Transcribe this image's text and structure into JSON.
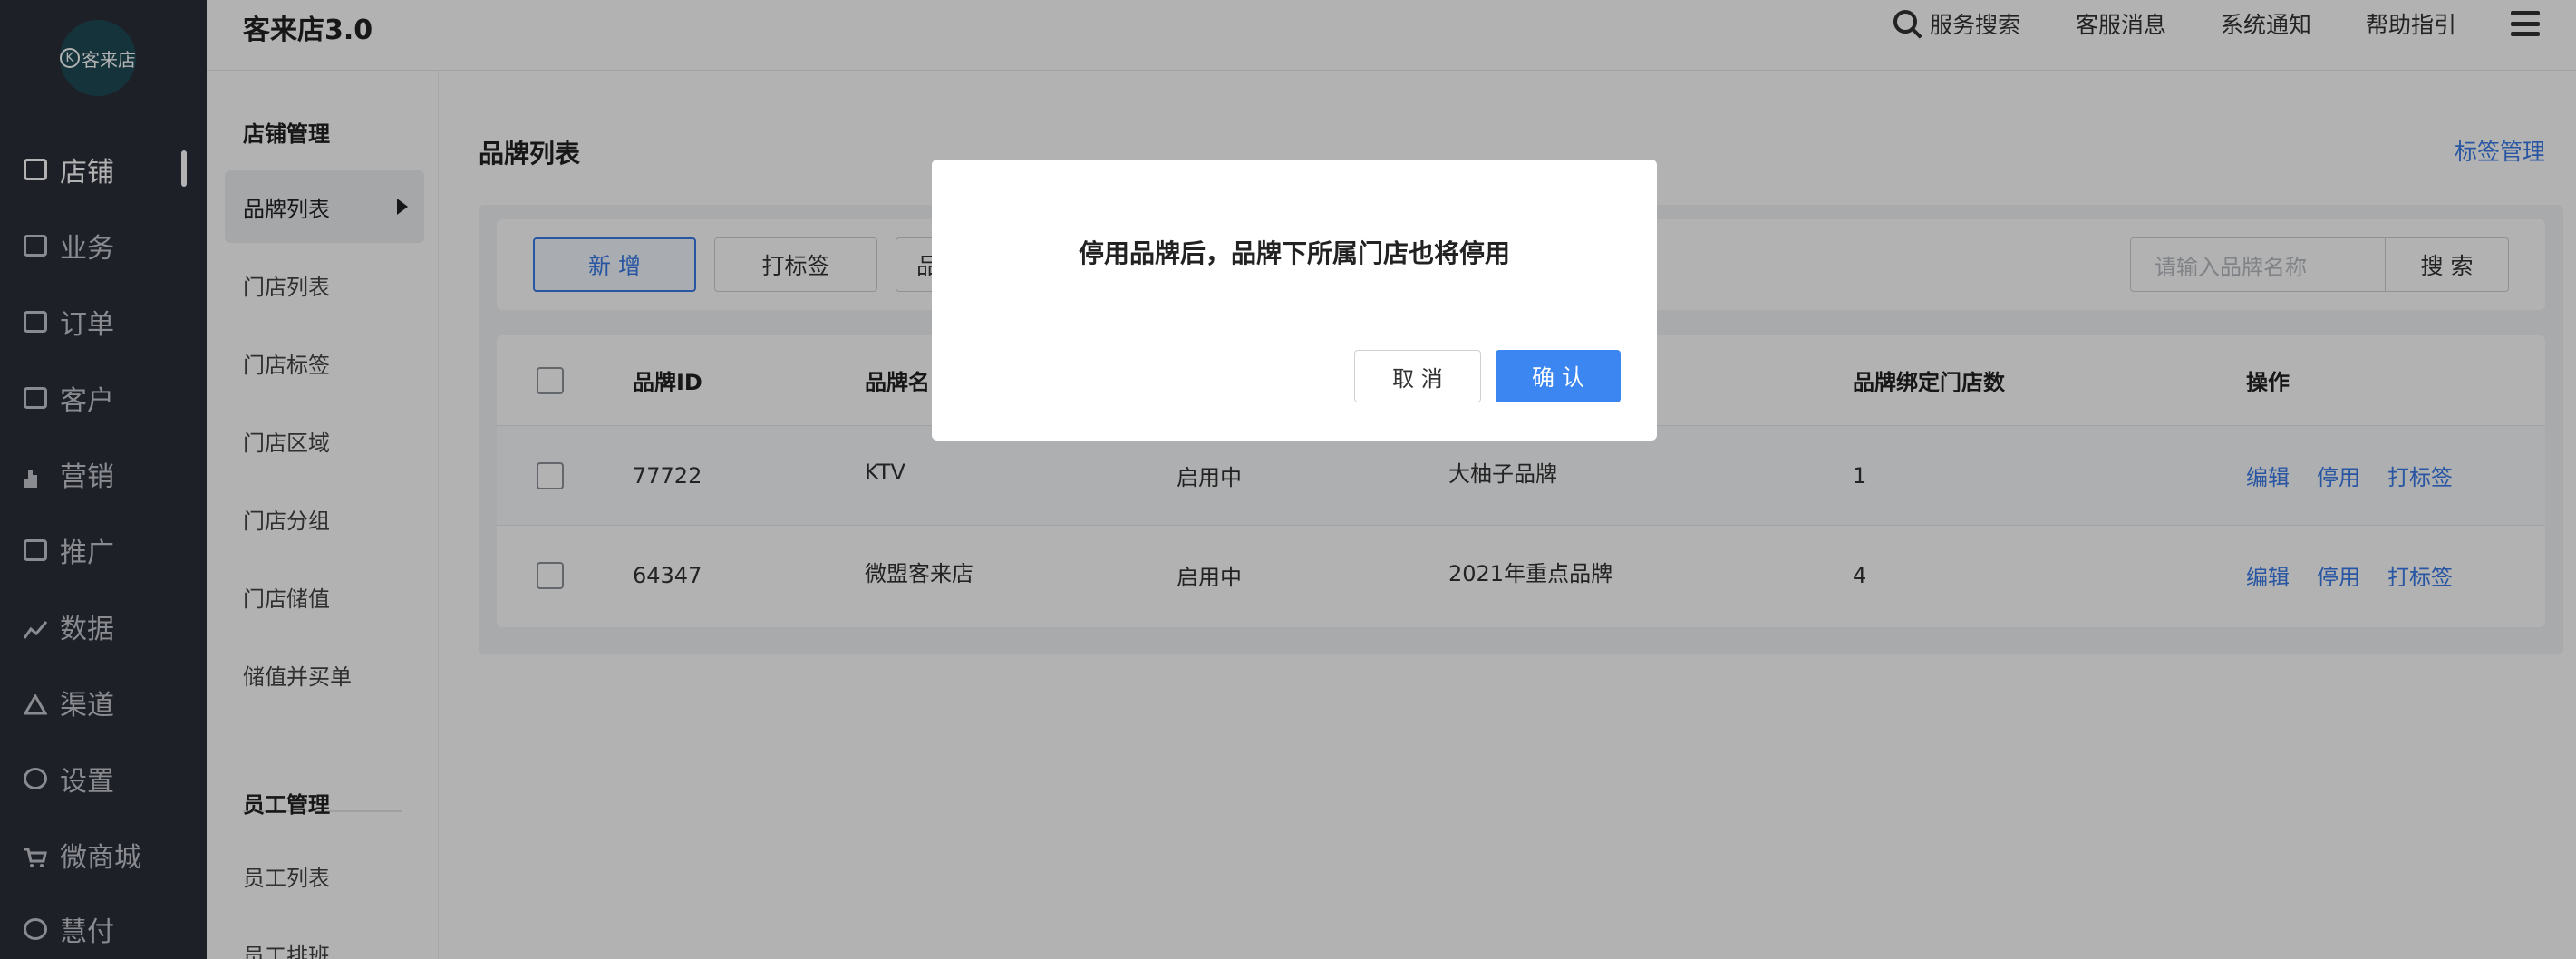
{
  "app": {
    "title": "客来店3.0",
    "logo_text": "客来店",
    "logo_letter": "K"
  },
  "topbar": {
    "search_label": "服务搜索",
    "links": [
      "客服消息",
      "系统通知",
      "帮助指引"
    ]
  },
  "leftnav": {
    "items": [
      {
        "label": "店铺",
        "icon": "store-icon",
        "active": true
      },
      {
        "label": "业务",
        "icon": "briefcase-icon"
      },
      {
        "label": "订单",
        "icon": "order-icon"
      },
      {
        "label": "客户",
        "icon": "vip-card-icon"
      },
      {
        "label": "营销",
        "icon": "bar-chart-icon"
      },
      {
        "label": "推广",
        "icon": "monitor-icon"
      },
      {
        "label": "数据",
        "icon": "line-chart-icon"
      },
      {
        "label": "渠道",
        "icon": "channel-icon"
      },
      {
        "label": "设置",
        "icon": "gear-icon"
      },
      {
        "label": "微商城",
        "icon": "cart-icon"
      },
      {
        "label": "慧付",
        "icon": "pay-icon"
      }
    ]
  },
  "subnav": {
    "group1": "店铺管理",
    "items1": [
      "品牌列表",
      "门店列表",
      "门店标签",
      "门店区域",
      "门店分组",
      "门店储值",
      "储值并买单"
    ],
    "group2": "员工管理",
    "items2": [
      "员工列表",
      "员工排班"
    ]
  },
  "main": {
    "title": "品牌列表",
    "tag_manage": "标签管理",
    "buttons": {
      "add": "新 增",
      "tag": "打标签",
      "partial": "品"
    },
    "search": {
      "placeholder": "请输入品牌名称",
      "button": "搜 索"
    },
    "table": {
      "headers": [
        "品牌ID",
        "品牌名",
        "",
        "",
        "品牌绑定门店数",
        "操作"
      ],
      "rows": [
        {
          "id": "77722",
          "name": "KTV",
          "status": "启用中",
          "tag": "大柚子品牌",
          "count": "1"
        },
        {
          "id": "64347",
          "name": "微盟客来店",
          "status": "启用中",
          "tag": "2021年重点品牌",
          "count": "4"
        }
      ],
      "actions": [
        "编辑",
        "停用",
        "打标签"
      ]
    }
  },
  "modal": {
    "message": "停用品牌后，品牌下所属门店也将停用",
    "cancel": "取 消",
    "confirm": "确 认"
  }
}
